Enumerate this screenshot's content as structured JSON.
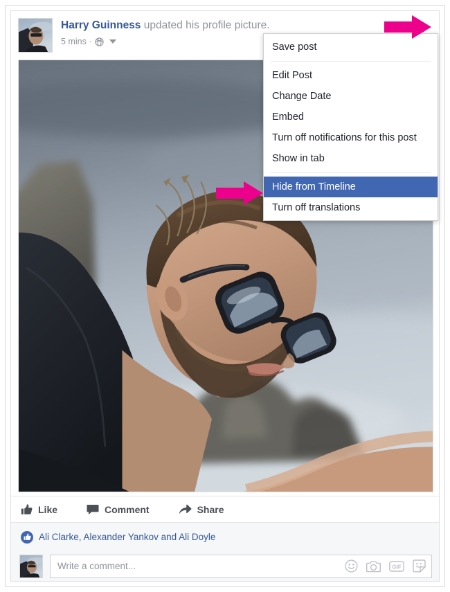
{
  "post": {
    "author": "Harry Guinness",
    "action_text": " updated his profile picture.",
    "timestamp": "5 mins",
    "meta_separator": "·",
    "privacy_icon": "globe-icon",
    "chevron_icon": "chevron-down-icon",
    "photo_alt": "profile-photo"
  },
  "actions": {
    "like": "Like",
    "comment": "Comment",
    "share": "Share"
  },
  "likes": {
    "names": "Ali Clarke, Alexander Yankov and Ali Doyle",
    "badge_icon": "thumbs-up-icon",
    "badge_color": "#4267b2"
  },
  "composer": {
    "placeholder": "Write a comment...",
    "value": "",
    "icons": [
      "emoji-icon",
      "camera-icon",
      "gif-icon",
      "sticker-icon"
    ]
  },
  "dropdown": {
    "items": [
      {
        "label": "Save post",
        "selected": false
      },
      {
        "label": "Edit Post",
        "selected": false
      },
      {
        "label": "Change Date",
        "selected": false
      },
      {
        "label": "Embed",
        "selected": false
      },
      {
        "label": "Turn off notifications for this post",
        "selected": false
      },
      {
        "label": "Show in tab",
        "selected": false
      },
      {
        "label": "Hide from Timeline",
        "selected": true
      },
      {
        "label": "Turn off translations",
        "selected": false
      }
    ],
    "highlight_color": "#4267b2"
  },
  "annotations": {
    "arrow_color": "#ec008c",
    "arrow_top_target": "chevron-down-icon",
    "arrow_menu_target": "Hide from Timeline"
  }
}
